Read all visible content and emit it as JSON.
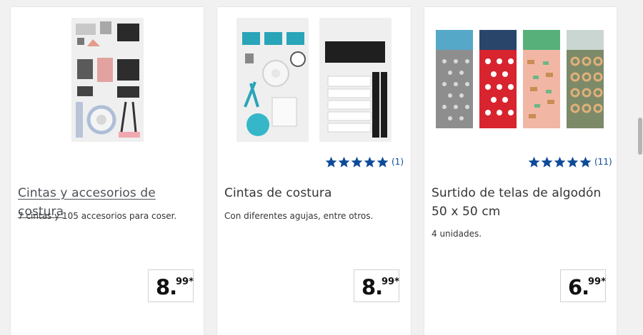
{
  "products": [
    {
      "title": "Cintas y accesorios de costura",
      "description": "7 cintas y 105 accesorios para coser.",
      "price_int": "8.",
      "price_dec": "99*",
      "image_alt": "sewing-kit-image"
    },
    {
      "title": "Cintas de costura",
      "description": "Con diferentes agujas, entre otros.",
      "price_int": "8.",
      "price_dec": "99*",
      "rating_stars": 5,
      "rating_count": "(1)"
    },
    {
      "title": "Surtido de telas de algodón 50 x 50 cm",
      "description": "4 unidades.",
      "price_int": "6.",
      "price_dec": "99*",
      "rating_stars": 5,
      "rating_count": "(11)"
    }
  ],
  "colors": {
    "rating_blue": "#0d4b98",
    "card_bg": "#ffffff",
    "page_bg": "#f1f1f1"
  }
}
